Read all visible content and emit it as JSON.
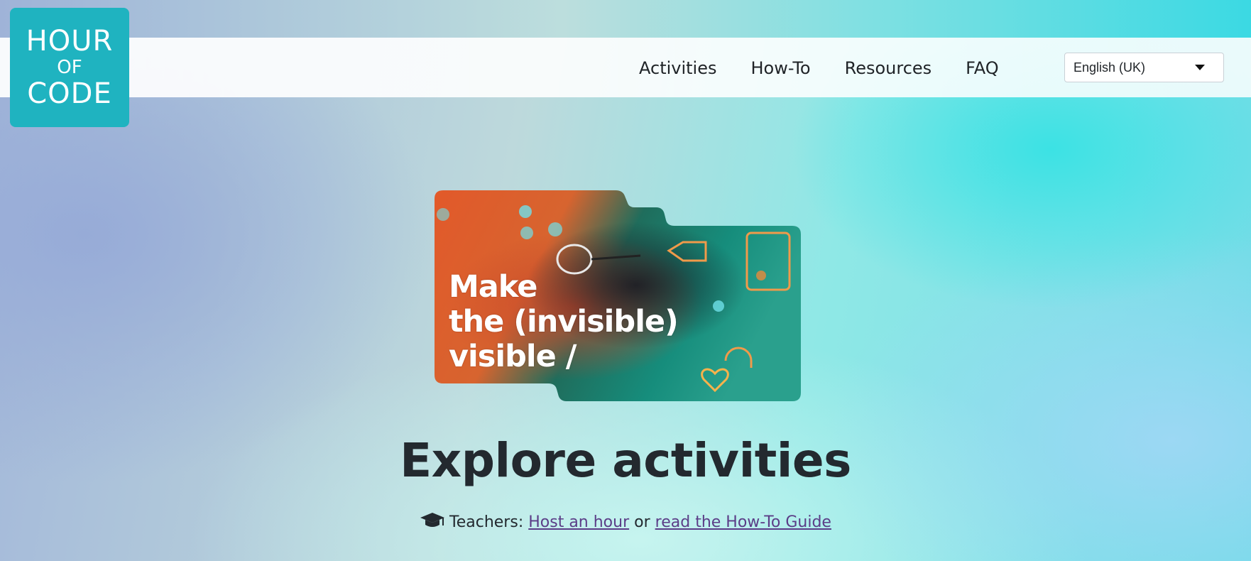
{
  "logo": {
    "line1": "HOUR",
    "line2": "OF",
    "line3": "CODE"
  },
  "nav": {
    "items": [
      {
        "label": "Activities"
      },
      {
        "label": "How-To"
      },
      {
        "label": "Resources"
      },
      {
        "label": "FAQ"
      }
    ]
  },
  "language": {
    "selected": "English (UK)"
  },
  "hero": {
    "line1": "Make",
    "line2": "the (invisible)",
    "line3": "visible /"
  },
  "main": {
    "title": "Explore activities",
    "teachers_label": "Teachers:",
    "host_link": "Host an hour",
    "or_text": "or",
    "guide_link": "read the How-To Guide"
  },
  "icons": {
    "teachers": "graduation-cap-icon",
    "dropdown": "caret-down-icon"
  },
  "colors": {
    "logo_bg": "#1fb3c0",
    "link": "#5b3d87",
    "heading": "#23292f"
  }
}
